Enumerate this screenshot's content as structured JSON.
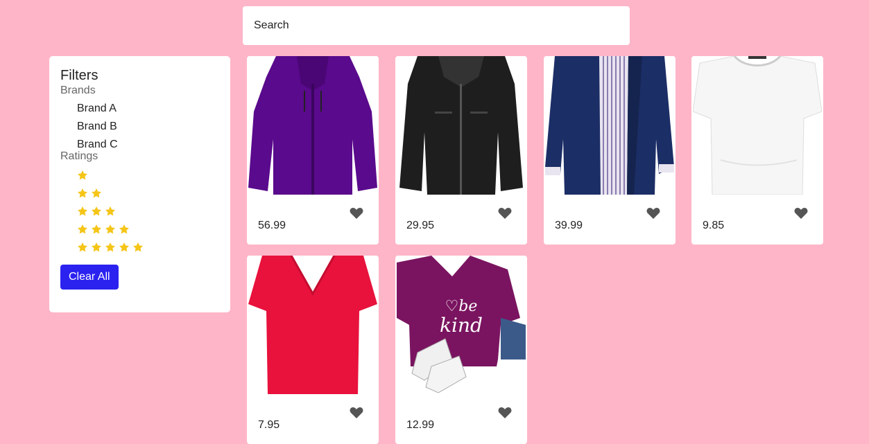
{
  "search": {
    "placeholder": "Search"
  },
  "filters": {
    "title": "Filters",
    "brands_heading": "Brands",
    "brands": [
      "Brand A",
      "Brand B",
      "Brand C"
    ],
    "ratings_heading": "Ratings",
    "ratings": [
      1,
      2,
      3,
      4,
      5
    ],
    "clear_label": "Clear All"
  },
  "products": [
    {
      "price": "56.99",
      "image": "purple-jacket"
    },
    {
      "price": "29.95",
      "image": "black-leather-jacket"
    },
    {
      "price": "39.99",
      "image": "navy-coat"
    },
    {
      "price": "9.85",
      "image": "white-top"
    },
    {
      "price": "7.95",
      "image": "red-tshirt"
    },
    {
      "price": "12.99",
      "image": "purple-be-kind-tshirt"
    }
  ],
  "colors": {
    "background": "#ffb5c8",
    "accent": "#2b22f0",
    "star": "#f5c518",
    "heart": "#555555"
  }
}
